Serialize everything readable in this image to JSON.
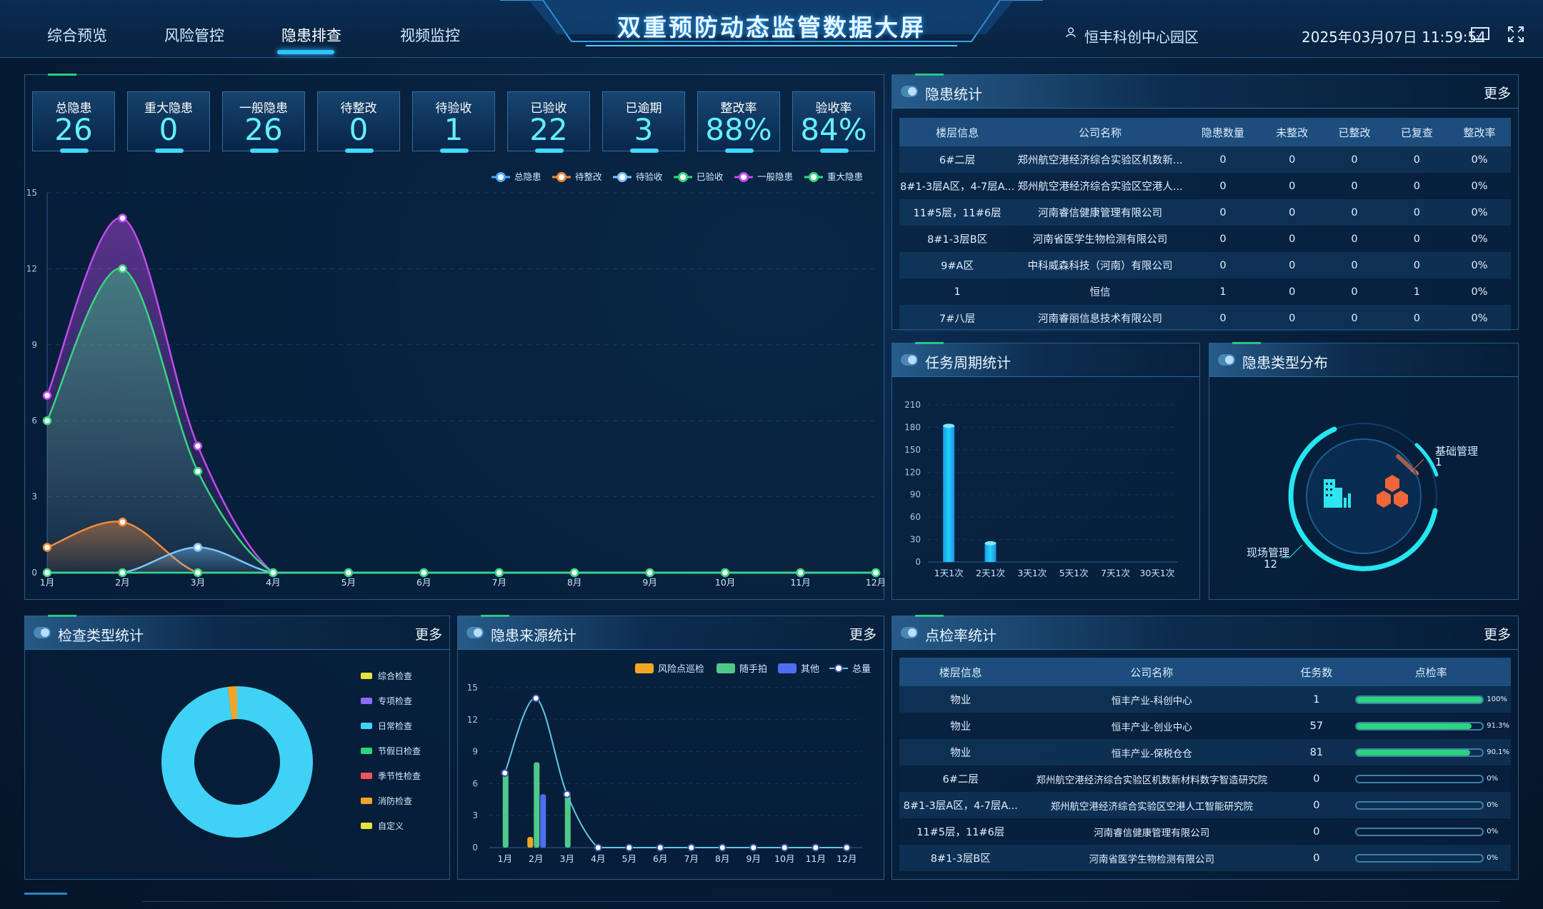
{
  "header": {
    "nav": [
      "综合预览",
      "风险管控",
      "隐患排查",
      "视频监控"
    ],
    "active_nav": 2,
    "title": "双重预防动态监管数据大屏",
    "park": "恒丰科创中心园区",
    "datetime": "2025年03月07日 11:59:54",
    "icons": [
      "user-icon",
      "monitor-icon",
      "fullscreen-icon"
    ]
  },
  "stats": [
    {
      "label": "总隐患",
      "value": "26"
    },
    {
      "label": "重大隐患",
      "value": "0"
    },
    {
      "label": "一般隐患",
      "value": "26"
    },
    {
      "label": "待整改",
      "value": "0"
    },
    {
      "label": "待验收",
      "value": "1"
    },
    {
      "label": "已验收",
      "value": "22"
    },
    {
      "label": "已逾期",
      "value": "3"
    },
    {
      "label": "整改率",
      "value": "88%"
    },
    {
      "label": "验收率",
      "value": "84%"
    }
  ],
  "hazard_stats": {
    "title": "隐患统计",
    "more": "更多",
    "columns": [
      "楼层信息",
      "公司名称",
      "隐患数量",
      "未整改",
      "已整改",
      "已复查",
      "整改率"
    ],
    "rows": [
      [
        "6#二层",
        "郑州航空港经济综合实验区机数新...",
        "0",
        "0",
        "0",
        "0",
        "0%"
      ],
      [
        "8#1-3层A区，4-7层A...",
        "郑州航空港经济综合实验区空港人...",
        "0",
        "0",
        "0",
        "0",
        "0%"
      ],
      [
        "11#5层，11#6层",
        "河南睿信健康管理有限公司",
        "0",
        "0",
        "0",
        "0",
        "0%"
      ],
      [
        "8#1-3层B区",
        "河南省医学生物检测有限公司",
        "0",
        "0",
        "0",
        "0",
        "0%"
      ],
      [
        "9#A区",
        "中科威森科技（河南）有限公司",
        "0",
        "0",
        "0",
        "0",
        "0%"
      ],
      [
        "1",
        "恒信",
        "1",
        "0",
        "0",
        "1",
        "0%"
      ],
      [
        "7#八层",
        "河南睿丽信息技术有限公司",
        "0",
        "0",
        "0",
        "0",
        "0%"
      ]
    ]
  },
  "task_cycle": {
    "title": "任务周期统计"
  },
  "hazard_type": {
    "title": "隐患类型分布",
    "items": [
      {
        "name": "基础管理",
        "value": "1"
      },
      {
        "name": "现场管理",
        "value": "12"
      }
    ]
  },
  "check_type": {
    "title": "检查类型统计",
    "more": "更多",
    "legend": [
      {
        "name": "综合检查",
        "color": "#e7e23a"
      },
      {
        "name": "专项检查",
        "color": "#8b6cf5"
      },
      {
        "name": "日常检查",
        "color": "#3fd2f5"
      },
      {
        "name": "节假日检查",
        "color": "#2bd57a"
      },
      {
        "name": "季节性检查",
        "color": "#f0555a"
      },
      {
        "name": "消防检查",
        "color": "#f0a52a"
      },
      {
        "name": "自定义",
        "color": "#e7e23a"
      }
    ]
  },
  "hazard_source": {
    "title": "隐患来源统计",
    "more": "更多",
    "legend": [
      "风险点巡检",
      "随手拍",
      "其他",
      "总量"
    ]
  },
  "inspection_rate": {
    "title": "点检率统计",
    "more": "更多",
    "columns": [
      "楼层信息",
      "公司名称",
      "任务数",
      "点检率"
    ],
    "rows": [
      {
        "floor": "物业",
        "company": "恒丰产业-科创中心",
        "tasks": "1",
        "rate": 1.0,
        "rate_label": "100%"
      },
      {
        "floor": "物业",
        "company": "恒丰产业-创业中心",
        "tasks": "57",
        "rate": 0.913,
        "rate_label": "91.3%"
      },
      {
        "floor": "物业",
        "company": "恒丰产业-保税仓仓",
        "tasks": "81",
        "rate": 0.901,
        "rate_label": "90.1%"
      },
      {
        "floor": "6#二层",
        "company": "郑州航空港经济综合实验区机数新材料数字智造研究院",
        "tasks": "0",
        "rate": 0,
        "rate_label": "0%"
      },
      {
        "floor": "8#1-3层A区，4-7层A...",
        "company": "郑州航空港经济综合实验区空港人工智能研究院",
        "tasks": "0",
        "rate": 0,
        "rate_label": "0%"
      },
      {
        "floor": "11#5层，11#6层",
        "company": "河南睿信健康管理有限公司",
        "tasks": "0",
        "rate": 0,
        "rate_label": "0%"
      },
      {
        "floor": "8#1-3层B区",
        "company": "河南省医学生物检测有限公司",
        "tasks": "0",
        "rate": 0,
        "rate_label": "0%"
      }
    ]
  },
  "chart_data": [
    {
      "type": "line",
      "title": "",
      "x": [
        "1月",
        "2月",
        "3月",
        "4月",
        "5月",
        "6月",
        "7月",
        "8月",
        "9月",
        "10月",
        "11月",
        "12月"
      ],
      "ylim": [
        0,
        15
      ],
      "yticks": [
        "0",
        "3",
        "6",
        "9",
        "12",
        "15"
      ],
      "legend_position": "top-right",
      "series": [
        {
          "name": "总隐患",
          "color": "#4aa8ff",
          "values": [
            0,
            0,
            0,
            0,
            0,
            0,
            0,
            0,
            0,
            0,
            0,
            0
          ]
        },
        {
          "name": "待整改",
          "color": "#f08a3a",
          "values": [
            1,
            2,
            0,
            0,
            0,
            0,
            0,
            0,
            0,
            0,
            0,
            0
          ]
        },
        {
          "name": "待验收",
          "color": "#7cc4ff",
          "values": [
            0,
            0,
            1,
            0,
            0,
            0,
            0,
            0,
            0,
            0,
            0,
            0
          ]
        },
        {
          "name": "已验收",
          "color": "#36d67e",
          "values": [
            6,
            12,
            4,
            0,
            0,
            0,
            0,
            0,
            0,
            0,
            0,
            0
          ]
        },
        {
          "name": "一般隐患",
          "color": "#c04bf0",
          "values": [
            7,
            14,
            5,
            0,
            0,
            0,
            0,
            0,
            0,
            0,
            0,
            0
          ]
        },
        {
          "name": "重大隐患",
          "color": "#36d67e",
          "values": [
            0,
            0,
            0,
            0,
            0,
            0,
            0,
            0,
            0,
            0,
            0,
            0
          ]
        }
      ]
    },
    {
      "type": "bar",
      "title": "",
      "categories": [
        "1天1次",
        "2天1次",
        "3天1次",
        "5天1次",
        "7天1次",
        "30天1次"
      ],
      "values": [
        182,
        25,
        0,
        0,
        0,
        0
      ],
      "ylim": [
        0,
        210
      ],
      "yticks": [
        "0",
        "30",
        "60",
        "90",
        "120",
        "150",
        "180",
        "210"
      ]
    },
    {
      "type": "pie",
      "title": "",
      "categories": [
        "综合检查",
        "专项检查",
        "日常检查",
        "节假日检查",
        "季节性检查",
        "消防检查",
        "自定义"
      ],
      "values": [
        0,
        0,
        98,
        0,
        0,
        2,
        0
      ]
    },
    {
      "type": "bar",
      "title": "",
      "categories": [
        "1月",
        "2月",
        "3月",
        "4月",
        "5月",
        "6月",
        "7月",
        "8月",
        "9月",
        "10月",
        "11月",
        "12月"
      ],
      "ylim": [
        0,
        15
      ],
      "yticks": [
        "0",
        "3",
        "6",
        "9",
        "12",
        "15"
      ],
      "series": [
        {
          "name": "风险点巡检",
          "color": "#f5a623",
          "values": [
            0,
            1,
            0,
            0,
            0,
            0,
            0,
            0,
            0,
            0,
            0,
            0
          ]
        },
        {
          "name": "随手拍",
          "color": "#4fc98a",
          "values": [
            7,
            8,
            5,
            0,
            0,
            0,
            0,
            0,
            0,
            0,
            0,
            0
          ]
        },
        {
          "name": "其他",
          "color": "#4f6df0",
          "values": [
            0,
            5,
            0,
            0,
            0,
            0,
            0,
            0,
            0,
            0,
            0,
            0
          ]
        },
        {
          "name": "总量",
          "color": "#5fc8e8",
          "values": [
            7,
            14,
            5,
            0,
            0,
            0,
            0,
            0,
            0,
            0,
            0,
            0
          ]
        }
      ]
    }
  ]
}
